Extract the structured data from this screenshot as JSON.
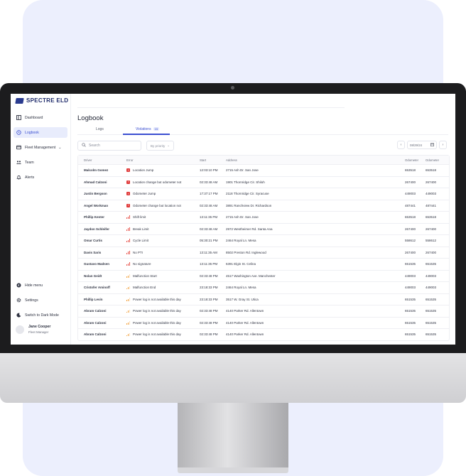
{
  "app": {
    "brand": "SPECTRE ELD"
  },
  "sidebar": {
    "items": [
      {
        "label": "Dashboard",
        "icon": "dashboard-icon"
      },
      {
        "label": "Logbook",
        "icon": "history-icon",
        "active": true
      },
      {
        "label": "Fleet Management",
        "icon": "truck-icon"
      },
      {
        "label": "Team",
        "icon": "team-icon"
      },
      {
        "label": "Alerts",
        "icon": "bell-icon"
      }
    ],
    "bottom": [
      {
        "label": "Hide menu",
        "icon": "collapse-icon"
      },
      {
        "label": "Settings",
        "icon": "gear-icon"
      },
      {
        "label": "Switch to Dark Mode",
        "icon": "moon-icon"
      }
    ],
    "user": {
      "name": "Jane Cooper",
      "role": "Fleet Manager"
    }
  },
  "page": {
    "title": "Logbook",
    "tabs": [
      {
        "label": "Logs"
      },
      {
        "label": "Violations",
        "count": "15"
      }
    ],
    "search_placeholder": "Search",
    "priority_label": "By priority",
    "date_value": "08/29/24",
    "prev_icon": "‹",
    "next_icon": "›"
  },
  "table": {
    "headers": {
      "driver": "Driver",
      "error": "Error",
      "start": "Start",
      "address": "Address",
      "odo1": "Odometer",
      "odo2": "Odometer"
    },
    "severity_colors": {
      "critical": "#e03a3a",
      "high": "#e8554e",
      "medium": "#f2a03c"
    },
    "rows": [
      {
        "driver": "Malcolm Gomez",
        "severity": "critical",
        "error": "Location Jump",
        "start": "12:03:10 PM",
        "address": "2715 Ash Dr. San Jose",
        "odo1": "653518",
        "odo2": "653518"
      },
      {
        "driver": "Ahmad Calzoni",
        "severity": "critical",
        "error": "Location change but odometer not",
        "start": "02:33:48 AM",
        "address": "1901 Thornridge Cir. Shiloh",
        "odo1": "267400",
        "odo2": "267400"
      },
      {
        "driver": "Justin Bergson",
        "severity": "critical",
        "error": "Odometer Jump",
        "start": "17:37:17 PM",
        "address": "2118 Thornridge Cir. Syracuse",
        "odo1": "449003",
        "odo2": "449003"
      },
      {
        "driver": "Angel Workman",
        "severity": "critical",
        "error": "Odometer change but location not",
        "start": "02:33:48 AM",
        "address": "3891 Ranchview Dr. Richardson",
        "odo1": "487441",
        "odo2": "487441"
      },
      {
        "driver": "Phillip Kenter",
        "severity": "high",
        "error": "Shift limit",
        "start": "13:11:35 PM",
        "address": "2715 Ash Dr. San Jose",
        "odo1": "653518",
        "odo2": "653518"
      },
      {
        "driver": "Jaydon Schleifer",
        "severity": "high",
        "error": "Break Limit",
        "start": "02:33:48 AM",
        "address": "2972 Westheimer Rd. Santa Ana",
        "odo1": "267400",
        "odo2": "267400"
      },
      {
        "driver": "Omar Curtis",
        "severity": "high",
        "error": "Cycle Limit",
        "start": "05:30:21 PM",
        "address": "2464 Royal Ln. Mesa",
        "odo1": "558612",
        "odo2": "558612"
      },
      {
        "driver": "Davis Saris",
        "severity": "high",
        "error": "No PTI",
        "start": "13:11:35 AM",
        "address": "8502 Preston Rd. Inglewood",
        "odo1": "267400",
        "odo2": "267400"
      },
      {
        "driver": "Gustavo Madsen",
        "severity": "high",
        "error": "No signature",
        "start": "13:11:35 PM",
        "address": "6391 Elgin St. Celina",
        "odo1": "651535",
        "odo2": "651535"
      },
      {
        "driver": "Nolan Geidt",
        "severity": "medium",
        "error": "Malfunction Start",
        "start": "02:33:48 PM",
        "address": "4517 Washington Ave. Manchester",
        "odo1": "449003",
        "odo2": "449003"
      },
      {
        "driver": "Cristofer Aminoff",
        "severity": "medium",
        "error": "Malfunction End",
        "start": "23:18:33 PM",
        "address": "2464 Royal Ln. Mesa",
        "odo1": "449003",
        "odo2": "449003"
      },
      {
        "driver": "Phillip Levin",
        "severity": "medium",
        "error": "Power log is not available this day",
        "start": "23:18:33 PM",
        "address": "3517 W. Gray St. Utica",
        "odo1": "651535",
        "odo2": "651535"
      },
      {
        "driver": "Abram Calzoni",
        "severity": "medium",
        "error": "Power log is not available this day",
        "start": "02:33:48 PM",
        "address": "4140 Parker Rd. Allentown",
        "odo1": "651535",
        "odo2": "651535"
      },
      {
        "driver": "Abram Calzoni",
        "severity": "medium",
        "error": "Power log is not available this day",
        "start": "02:33:48 PM",
        "address": "4140 Parker Rd. Allentown",
        "odo1": "651535",
        "odo2": "651535"
      },
      {
        "driver": "Abram Calzoni",
        "severity": "medium",
        "error": "Power log is not available this day",
        "start": "02:33:48 PM",
        "address": "4140 Parker Rd. Allentown",
        "odo1": "651535",
        "odo2": "651535"
      }
    ]
  }
}
